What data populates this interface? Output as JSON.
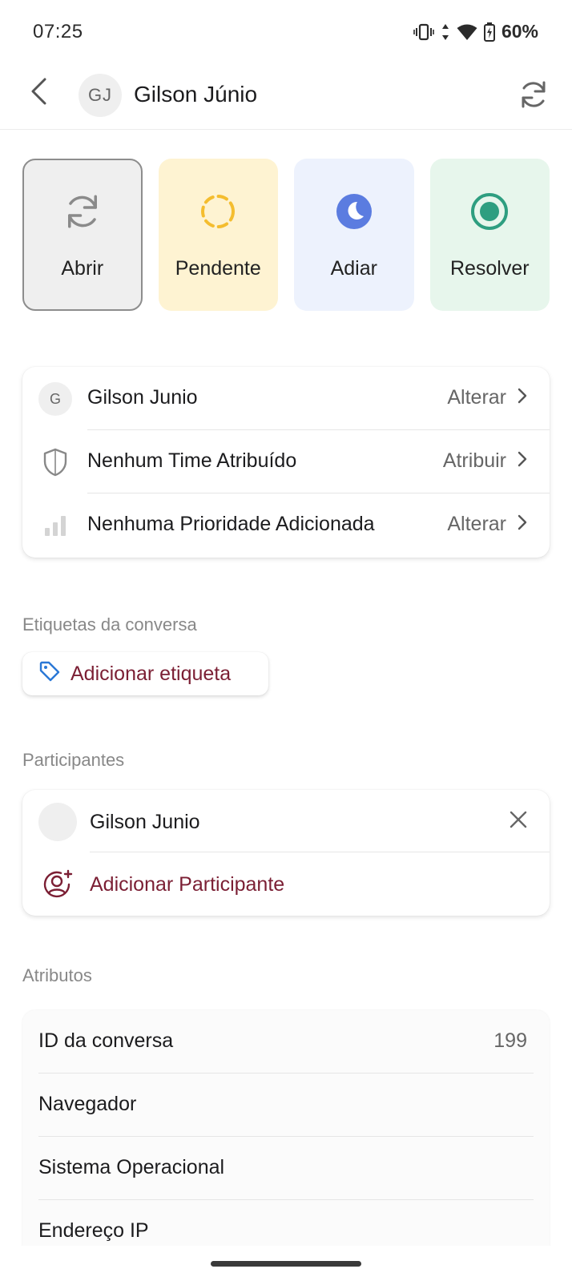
{
  "status_bar": {
    "time": "07:25",
    "battery": "60%",
    "icons": [
      "vibrate-icon",
      "data-arrows-icon",
      "wifi-icon",
      "battery-charging-icon"
    ]
  },
  "header": {
    "back_icon": "chevron-left-icon",
    "avatar_initials": "GJ",
    "contact_name": "Gilson Júnio",
    "refresh_icon": "refresh-icon"
  },
  "actions": [
    {
      "label": "Abrir",
      "icon": "refresh-icon",
      "color": "#8a8a8a"
    },
    {
      "label": "Pendente",
      "icon": "dashed-circle-icon",
      "color": "#f4bd2f"
    },
    {
      "label": "Adiar",
      "icon": "moon-icon",
      "color": "#5b7ce0"
    },
    {
      "label": "Resolver",
      "icon": "radio-checked-icon",
      "color": "#2e9e80"
    }
  ],
  "conversation_info": {
    "assignee": {
      "initial": "G",
      "name": "Gilson Junio",
      "action": "Alterar"
    },
    "team": {
      "label": "Nenhum Time Atribuído",
      "action": "Atribuir"
    },
    "priority": {
      "label": "Nenhuma Prioridade Adicionada",
      "action": "Alterar"
    }
  },
  "labels_section": {
    "title": "Etiquetas da conversa",
    "add_label": "Adicionar etiqueta"
  },
  "participants_section": {
    "title": "Participantes",
    "participants": [
      {
        "name": "Gilson Junio"
      }
    ],
    "add_participant": "Adicionar Participante"
  },
  "attributes_section": {
    "title": "Atributos",
    "rows": [
      {
        "label": "ID da conversa",
        "value": "199"
      },
      {
        "label": "Navegador",
        "value": ""
      },
      {
        "label": "Sistema Operacional",
        "value": ""
      },
      {
        "label": "Endereço IP",
        "value": ""
      }
    ]
  },
  "colors": {
    "accent": "#7b1f34",
    "pending_bg": "#fef3d2",
    "snooze_bg": "#edf2fd",
    "resolve_bg": "#e7f6ec"
  }
}
